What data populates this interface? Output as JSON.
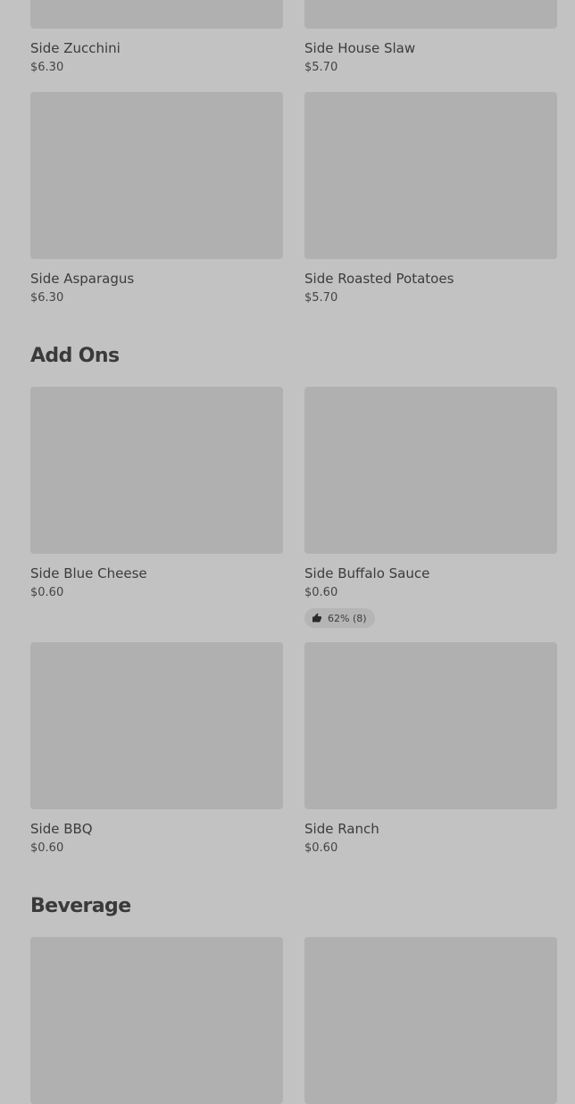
{
  "sides": {
    "items": [
      {
        "name": "Side Zucchini",
        "price": "$6.30"
      },
      {
        "name": "Side House Slaw",
        "price": "$5.70"
      },
      {
        "name": "Side Asparagus",
        "price": "$6.30"
      },
      {
        "name": "Side Roasted Potatoes",
        "price": "$5.70"
      }
    ]
  },
  "add_ons": {
    "title": "Add Ons",
    "items": [
      {
        "name": "Side Blue Cheese",
        "price": "$0.60"
      },
      {
        "name": "Side Buffalo Sauce",
        "price": "$0.60",
        "rating": "62% (8)",
        "rating_icon": "thumbs-up-icon"
      },
      {
        "name": "Side BBQ",
        "price": "$0.60"
      },
      {
        "name": "Side Ranch",
        "price": "$0.60"
      }
    ]
  },
  "beverage": {
    "title": "Beverage"
  }
}
